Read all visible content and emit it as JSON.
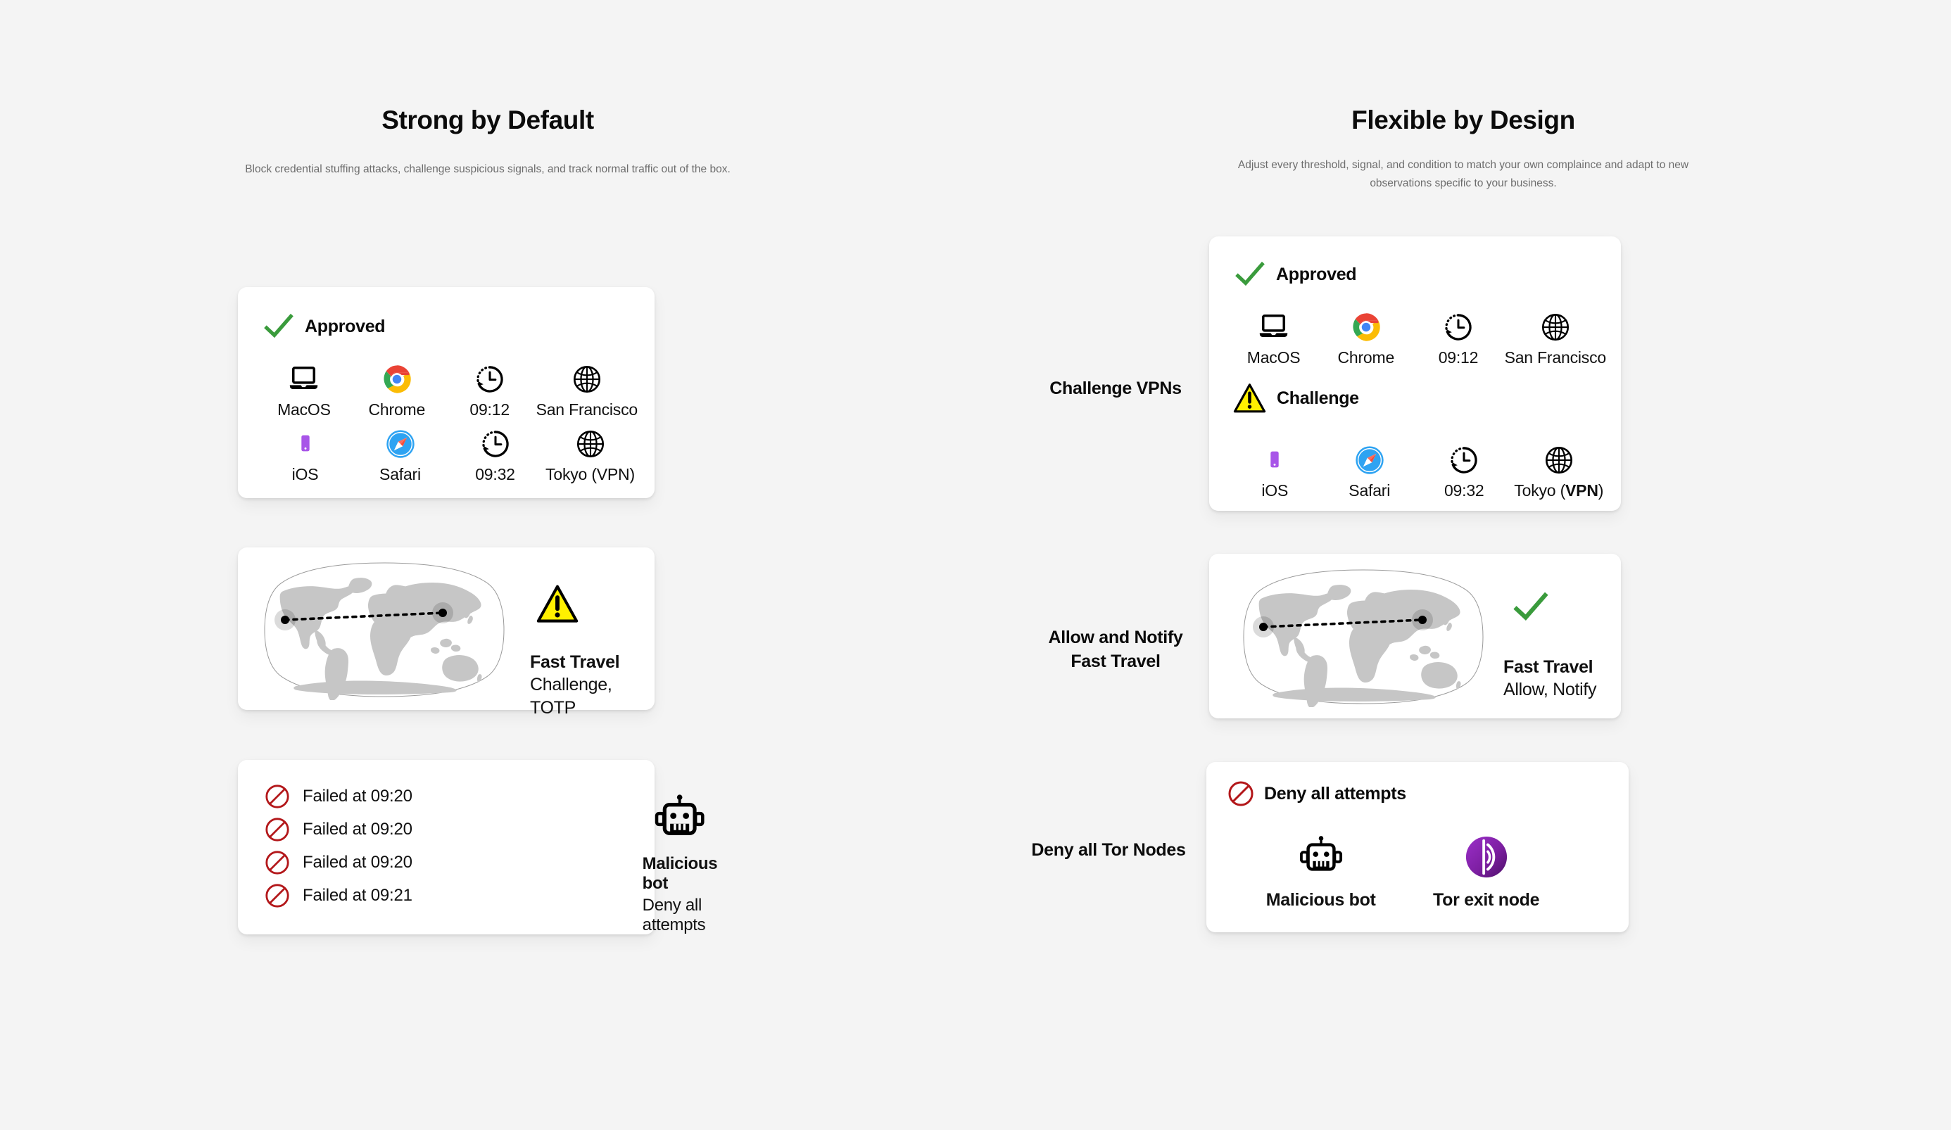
{
  "page": {
    "background": "#f4f4f4",
    "accent_green": "#3a9b3c",
    "accent_red": "#b3171a",
    "accent_yellow": "#fff000",
    "accent_purple": "#a855e8",
    "tor_purple": "#7d1fa2"
  },
  "left_column": {
    "title": "Strong by Default",
    "subtitle": "Block credential stuffing attacks, challenge suspicious signals, and track normal traffic out of the box.",
    "card_devices": {
      "status_label": "Approved",
      "status_icon": "check-icon",
      "rows": [
        [
          {
            "icon": "laptop-icon",
            "label": "MacOS"
          },
          {
            "icon": "chrome-icon",
            "label": "Chrome"
          },
          {
            "icon": "clock-history-icon",
            "label": "09:12"
          },
          {
            "icon": "globe-icon",
            "label": "San Francisco"
          }
        ],
        [
          {
            "icon": "phone-icon",
            "label": "iOS"
          },
          {
            "icon": "safari-icon",
            "label": "Safari"
          },
          {
            "icon": "clock-history-icon",
            "label": "09:32"
          },
          {
            "icon": "globe-icon",
            "label": "Tokyo (VPN)"
          }
        ]
      ]
    },
    "card_map": {
      "map_icon": "world-map",
      "status_icon": "warning-triangle-icon",
      "title": "Fast Travel",
      "subtitle": "Challenge, TOTP"
    },
    "card_failed": {
      "items": [
        {
          "icon": "prohibited-icon",
          "text": "Failed at 09:20"
        },
        {
          "icon": "prohibited-icon",
          "text": "Failed at 09:20"
        },
        {
          "icon": "prohibited-icon",
          "text": "Failed at 09:20"
        },
        {
          "icon": "prohibited-icon",
          "text": "Failed at 09:21"
        }
      ],
      "threat_icon": "robot-icon",
      "threat_title": "Malicious bot",
      "threat_subtitle": "Deny all attempts"
    }
  },
  "right_column": {
    "title": "Flexible by Design",
    "subtitle": "Adjust every threshold, signal, and condition to match your own complaince and adapt to new observations specific to your business.",
    "card_devices": {
      "status_label_1": "Approved",
      "status_icon_1": "check-icon",
      "status_label_2": "Challenge",
      "status_icon_2": "warning-triangle-icon",
      "row1": [
        {
          "icon": "laptop-icon",
          "label": "MacOS"
        },
        {
          "icon": "chrome-icon",
          "label": "Chrome"
        },
        {
          "icon": "clock-history-icon",
          "label": "09:12"
        },
        {
          "icon": "globe-icon",
          "label": "San Francisco"
        }
      ],
      "row2": [
        {
          "icon": "phone-icon",
          "label": "iOS"
        },
        {
          "icon": "safari-icon",
          "label": "Safari"
        },
        {
          "icon": "clock-history-icon",
          "label": "09:32"
        },
        {
          "icon": "globe-icon",
          "label_prefix": "Tokyo (",
          "label_bold": "VPN",
          "label_suffix": ")"
        }
      ]
    },
    "card_map": {
      "map_icon": "world-map",
      "status_icon": "check-icon",
      "title": "Fast Travel",
      "subtitle": "Allow, Notify"
    },
    "card_deny": {
      "status_icon": "prohibited-icon",
      "status_label": "Deny all attempts",
      "threats": [
        {
          "icon": "robot-icon",
          "label": "Malicious bot"
        },
        {
          "icon": "tor-onion-icon",
          "label": "Tor exit node"
        }
      ]
    }
  },
  "annotations": [
    {
      "name": "challenge-vpns",
      "text": "Challenge VPNs"
    },
    {
      "name": "allow-notify-fast-travel",
      "line1": "Allow and Notify",
      "line2": "Fast Travel"
    },
    {
      "name": "deny-all-tor-nodes",
      "text": "Deny all Tor Nodes"
    }
  ]
}
